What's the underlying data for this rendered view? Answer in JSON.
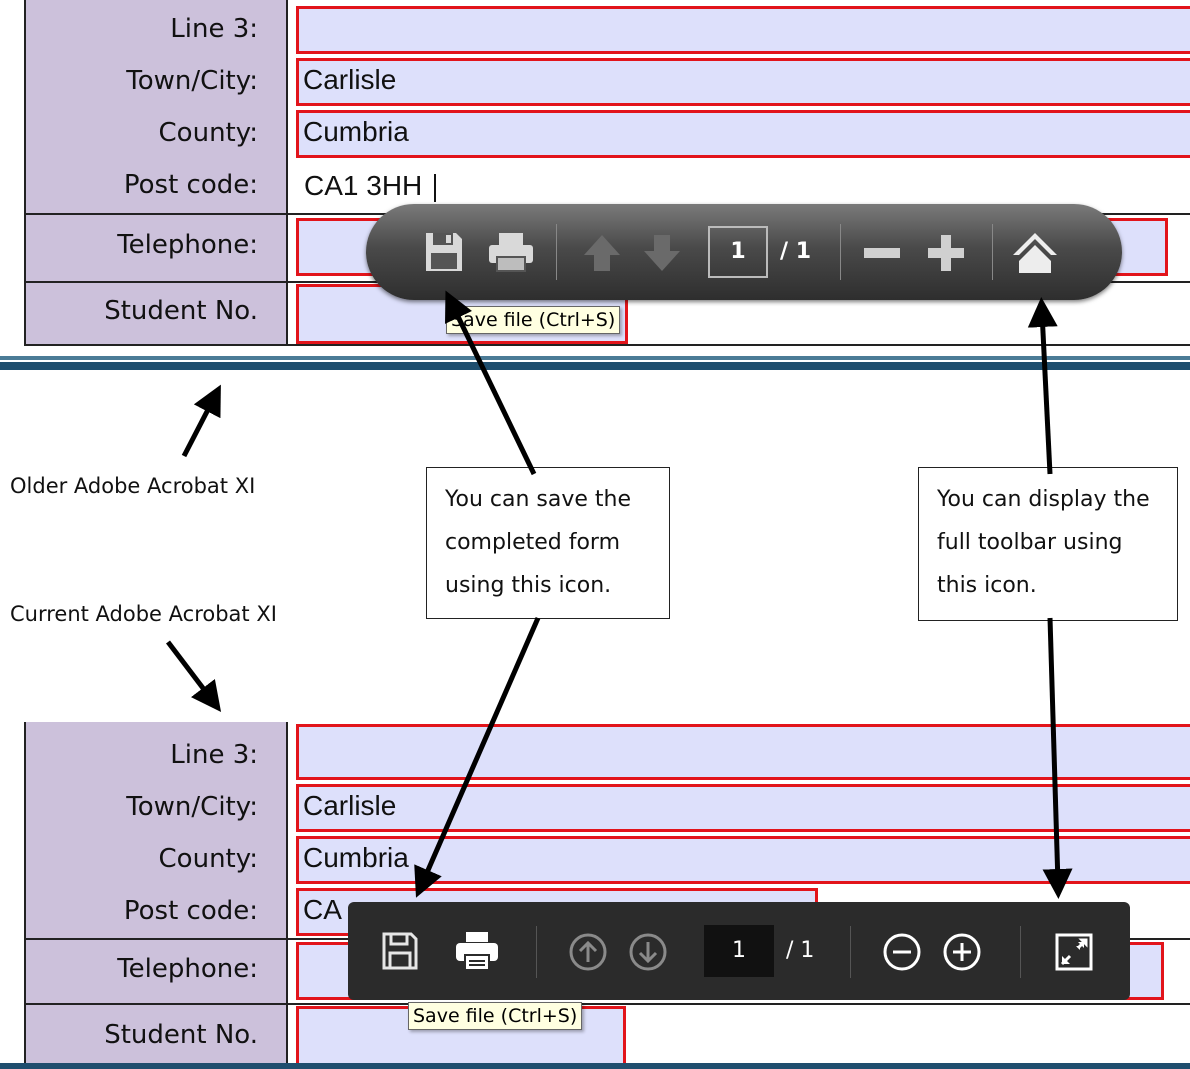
{
  "old_form": {
    "labels": {
      "line3": "Line 3:",
      "town": "Town/City:",
      "county": "County:",
      "postcode": "Post code:",
      "telephone": "Telephone:",
      "student_no": "Student No."
    },
    "values": {
      "line3": "",
      "town": "Carlisle",
      "county": "Cumbria",
      "postcode": "CA1 3HH",
      "telephone": "",
      "student_no": ""
    }
  },
  "old_toolbar": {
    "icons": [
      "save-icon",
      "print-icon",
      "page-up-icon",
      "page-down-icon",
      "zoom-out-icon",
      "zoom-in-icon",
      "home-icon"
    ],
    "page_current": "1",
    "page_total": "/ 1",
    "tooltip": "Save file (Ctrl+S)"
  },
  "new_form": {
    "labels": {
      "line3": "Line 3:",
      "town": "Town/City:",
      "county": "County:",
      "postcode": "Post code:",
      "telephone": "Telephone:",
      "student_no": "Student No."
    },
    "values": {
      "line3": "",
      "town": "Carlisle",
      "county": "Cumbria",
      "postcode": "CA",
      "telephone": "",
      "student_no": ""
    }
  },
  "new_toolbar": {
    "icons": [
      "save-icon",
      "print-icon",
      "prev-page-icon",
      "next-page-icon",
      "zoom-out-icon",
      "zoom-in-icon",
      "expand-toolbar-icon"
    ],
    "page_current": "1",
    "page_total": "/ 1",
    "tooltip": "Save file (Ctrl+S)"
  },
  "captions": {
    "older": "Older Adobe Acrobat XI",
    "current": "Current Adobe Acrobat XI"
  },
  "callouts": {
    "save": "You can save the completed form using this icon.",
    "toolbar": "You can display the full toolbar using this icon."
  },
  "colors": {
    "label_bg": "#ccc1db",
    "field_bg": "#dde0fb",
    "field_border": "#e2141b",
    "rule": "#1f4e6e"
  }
}
